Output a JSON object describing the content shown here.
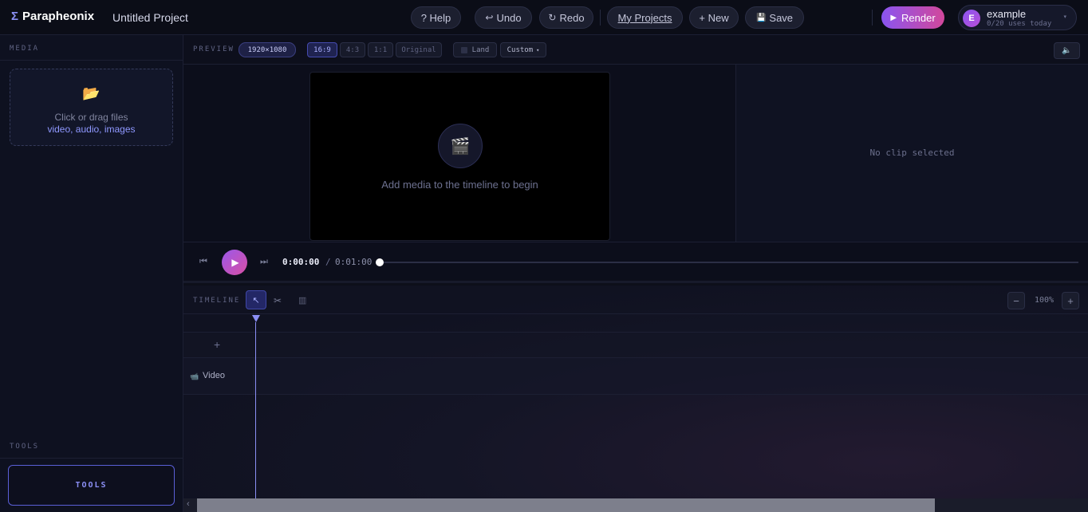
{
  "app": {
    "brand_symbol": "Σ",
    "brand_name": "Parapheonix",
    "project_title": "Untitled Project"
  },
  "toolbar": {
    "help": "? Help",
    "undo_icon": "↩",
    "undo": "Undo",
    "redo_icon": "↻",
    "redo": "Redo",
    "my_projects": "My Projects",
    "new": "+ New",
    "save_icon": "💾",
    "save": "Save",
    "render_icon": "▶",
    "render": "Render"
  },
  "user": {
    "initial": "E",
    "name": "example",
    "usage": "0/20 uses today",
    "caret": "▾"
  },
  "sidebar": {
    "media_label": "MEDIA",
    "dropzone_icon": "📂",
    "dropzone_line1": "Click or drag files",
    "dropzone_line2": "video, audio, images",
    "tools_label": "TOOLS",
    "tools_button": "TOOLS"
  },
  "preview": {
    "label": "PREVIEW",
    "resolution": "1920×1080",
    "aspect_options": [
      "16:9",
      "4:3",
      "1:1",
      "Original"
    ],
    "active_aspect": "16:9",
    "orientation": "Land",
    "custom": "Custom",
    "custom_caret": "▾",
    "mute_icon": "🔈",
    "clapper_icon": "🎬",
    "empty_hint": "Add media to the timeline to begin"
  },
  "inspector": {
    "empty": "No clip selected"
  },
  "transport": {
    "prev_icon": "⏮",
    "play_icon": "▶",
    "next_icon": "⏭",
    "current_time": "0:00:00",
    "separator": "/",
    "total_time": "0:01:00",
    "progress": 0
  },
  "timeline": {
    "label": "TIMELINE",
    "select_icon": "↖",
    "cut_icon": "✂",
    "delete_icon": "▥",
    "zoom_out": "−",
    "zoom_level": "100%",
    "zoom_in": "+",
    "add_track": "+",
    "tracks": [
      {
        "icon": "📹",
        "name": "Video"
      }
    ],
    "scroll_left_icon": "‹"
  },
  "colors": {
    "accent": "#8b8ff5",
    "render_gradient_start": "#8a55f0",
    "render_gradient_end": "#d2489b",
    "background": "#0d0f1a"
  }
}
